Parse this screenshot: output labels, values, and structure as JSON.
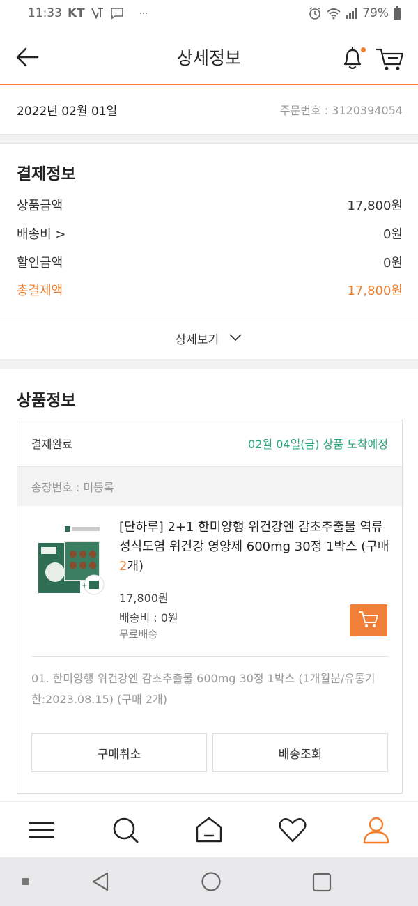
{
  "status_bar": {
    "time": "11:33",
    "carrier": "KT",
    "battery": "79%",
    "icons": [
      "lte-voice-icon",
      "message-icon",
      "more-dots-icon",
      "alarm-icon",
      "wifi-icon",
      "signal-icon",
      "battery-icon"
    ]
  },
  "header": {
    "title": "상세정보",
    "icons": [
      "back-arrow-icon",
      "bell-icon",
      "cart-icon"
    ]
  },
  "order": {
    "date": "2022년 02월 01일",
    "order_number": "주문번호 : 3120394054"
  },
  "payment": {
    "title": "결제정보",
    "rows": [
      {
        "label": "상품금액",
        "value": "17,800원"
      },
      {
        "label": "배송비 >",
        "value": "0원"
      },
      {
        "label": "할인금액",
        "value": "0원"
      },
      {
        "label": "총결제액",
        "value": "17,800원"
      }
    ],
    "more_label": "상세보기"
  },
  "product": {
    "title": "상품정보",
    "status": "결제완료",
    "eta": "02월 04일(금) 상품 도착예정",
    "tracking": "송장번호 : 미등록",
    "name_prefix": "[단하루] 2+1 한미양행 위건강엔 감초추출물 역류성식도염 위건강 영양제 600mg 30정 1박스 (구매 ",
    "name_qty": "2",
    "name_suffix": "개)",
    "price": "17,800원",
    "shipping": "배송비 : 0원",
    "shipping_note": "무료배송",
    "option": "01. 한미양행 위건강엔 감초추출물 600mg 30정 1박스 (1개월분/유통기한:2023.08.15) (구매 2개)",
    "cancel_label": "구매취소",
    "track_label": "배송조회"
  },
  "bottom_nav": {
    "items": [
      "menu-icon",
      "search-icon",
      "home-icon",
      "heart-icon",
      "user-icon"
    ],
    "active": "user-icon"
  },
  "colors": {
    "accent": "#f08030",
    "eta_green": "#2aa57c",
    "muted": "#999999"
  }
}
